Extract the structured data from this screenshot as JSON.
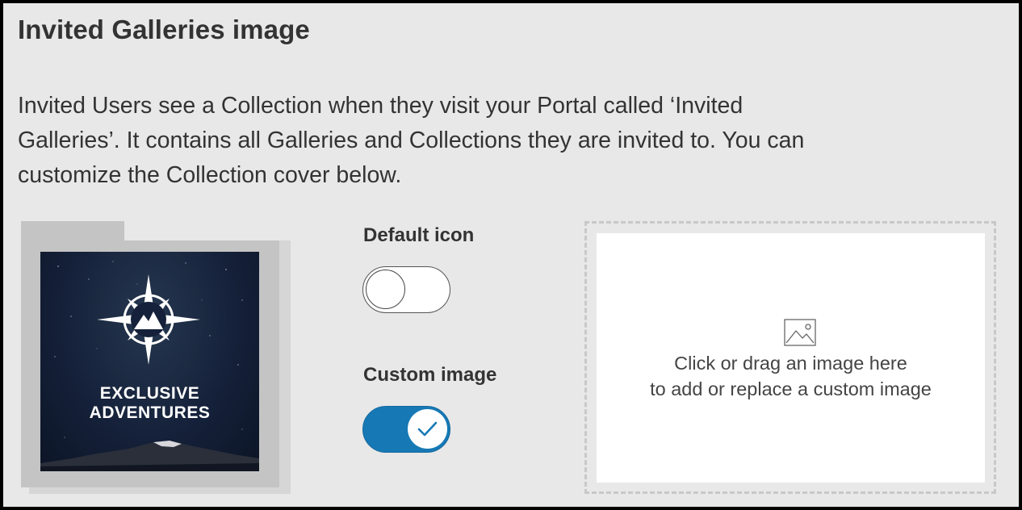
{
  "section": {
    "title": "Invited Galleries image",
    "description": "Invited Users see a Collection when they visit your Portal called ‘Invited\nGalleries’. It contains all Galleries and Collections they are invited to. You can\ncustomize the Collection cover below."
  },
  "preview": {
    "cover_line1": "EXCLUSIVE",
    "cover_line2": "ADVENTURES",
    "icon": "compass-mountain-logo"
  },
  "options": {
    "default_icon": {
      "label": "Default icon",
      "enabled": false
    },
    "custom_image": {
      "label": "Custom image",
      "enabled": true
    }
  },
  "dropzone": {
    "line1": "Click or drag an image here",
    "line2": "to add or replace a custom image",
    "icon": "image-icon"
  },
  "colors": {
    "background": "#e8e8e8",
    "toggle_on": "#1679b5",
    "text": "#333333"
  }
}
